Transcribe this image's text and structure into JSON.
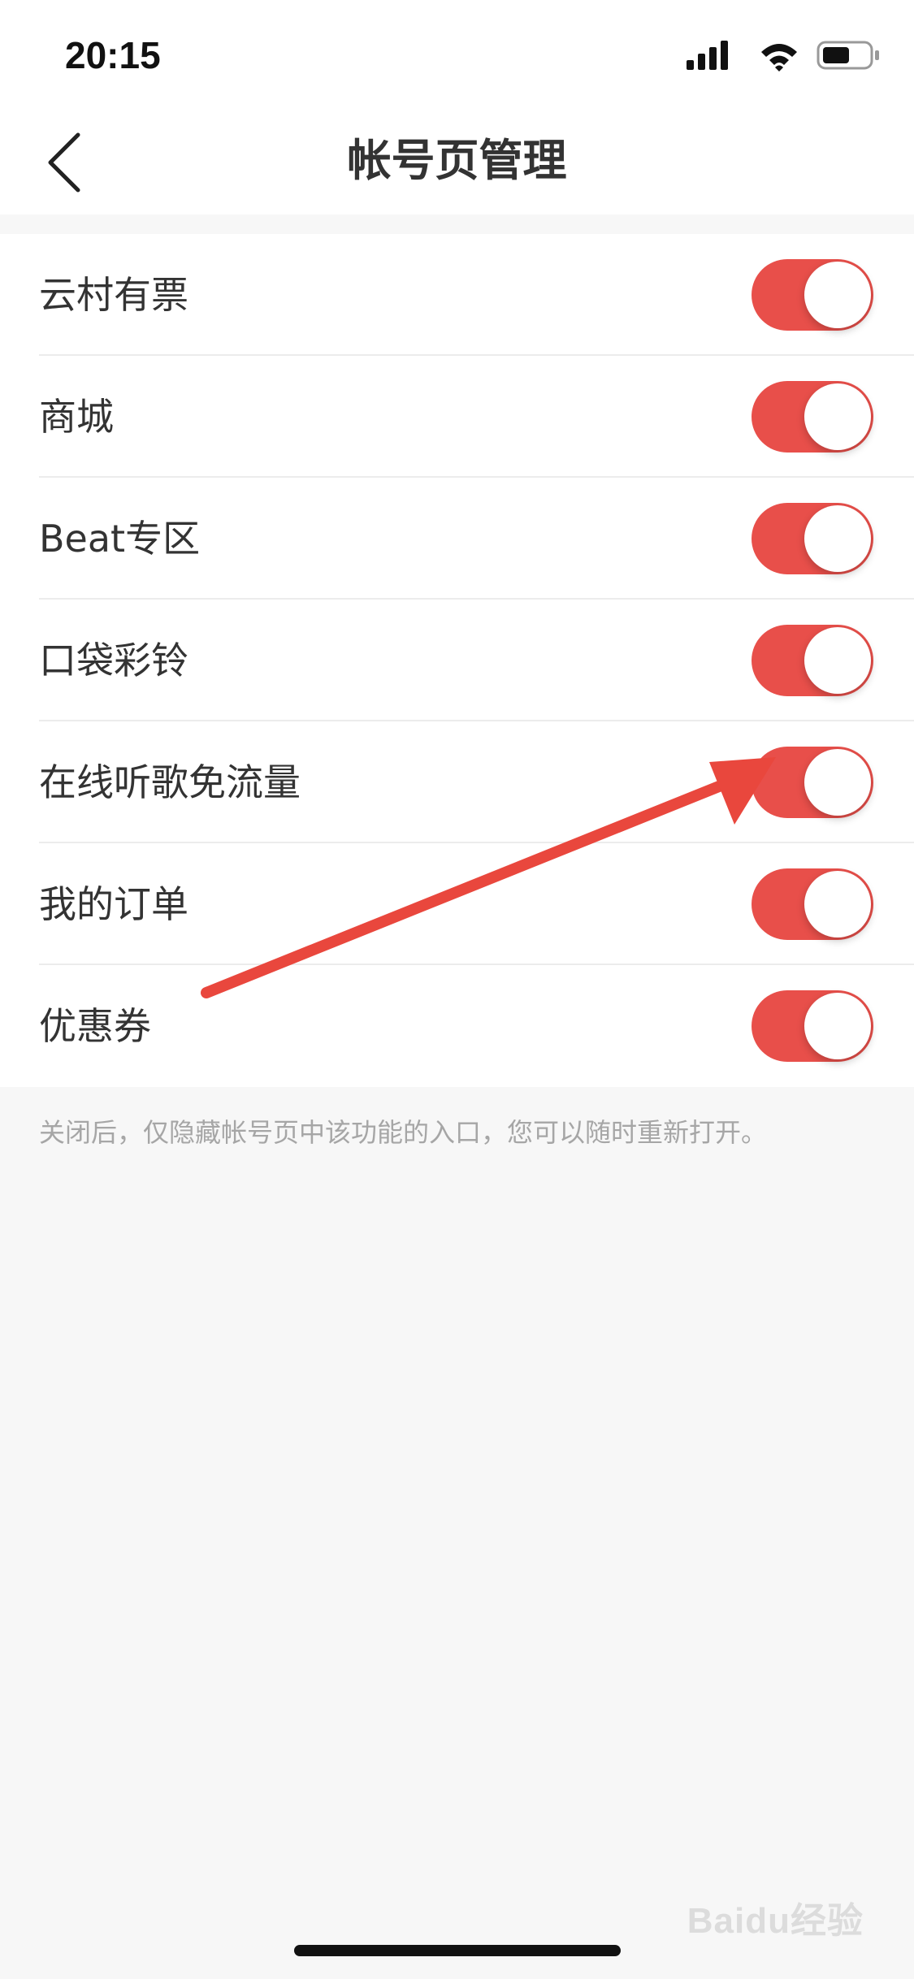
{
  "status_bar": {
    "time": "20:15",
    "icons": [
      "signal-icon",
      "wifi-icon",
      "battery-icon"
    ]
  },
  "nav": {
    "title": "帐号页管理",
    "back_icon": "chevron-left-icon"
  },
  "settings": {
    "items": [
      {
        "label": "云村有票",
        "enabled": true
      },
      {
        "label": "商城",
        "enabled": true
      },
      {
        "label": "Beat专区",
        "enabled": true
      },
      {
        "label": "口袋彩铃",
        "enabled": true
      },
      {
        "label": "在线听歌免流量",
        "enabled": true
      },
      {
        "label": "我的订单",
        "enabled": true
      },
      {
        "label": "优惠券",
        "enabled": true
      }
    ]
  },
  "footer": {
    "note": "关闭后，仅隐藏帐号页中该功能的入口，您可以随时重新打开。"
  },
  "watermark": {
    "text": "Baidu经验"
  },
  "colors": {
    "toggle_on": "#e84f4a",
    "annotation_arrow": "#e9473d",
    "background": "#f7f7f7"
  }
}
